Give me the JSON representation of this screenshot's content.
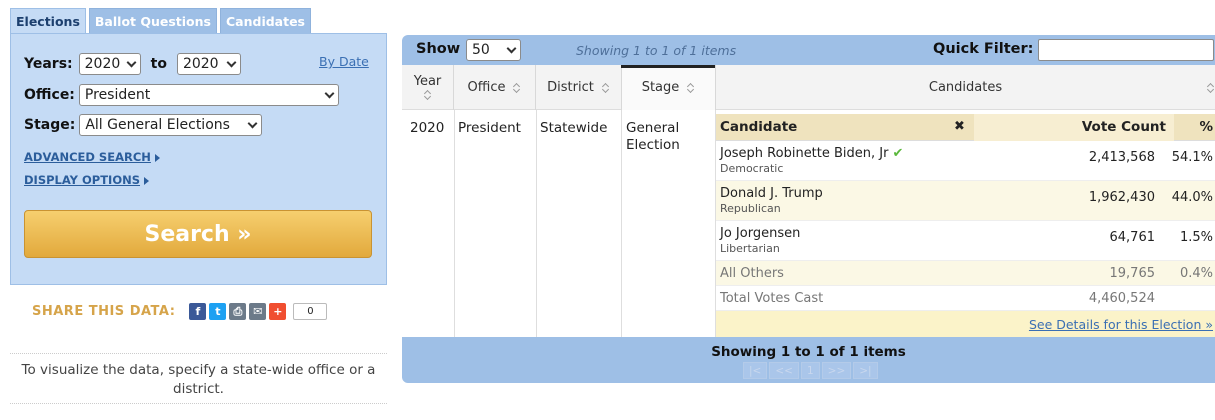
{
  "tabs": [
    {
      "label": "Elections"
    },
    {
      "label": "Ballot Questions"
    },
    {
      "label": "Candidates"
    }
  ],
  "search": {
    "years_label": "Years:",
    "year_from": "2020",
    "to_label": "to",
    "year_to": "2020",
    "by_date": "By Date",
    "office_label": "Office:",
    "office_value": "President",
    "stage_label": "Stage:",
    "stage_value": "All General Elections",
    "advanced_search": "ADVANCED SEARCH",
    "display_options": "DISPLAY OPTIONS",
    "search_button": "Search »"
  },
  "share": {
    "label": "SHARE THIS DATA:",
    "count": "0",
    "buttons": [
      {
        "icon": "facebook-icon",
        "glyph": "f",
        "color": "#3b5998"
      },
      {
        "icon": "twitter-icon",
        "glyph": "t",
        "color": "#1da1f2"
      },
      {
        "icon": "print-icon",
        "glyph": "⎙",
        "color": "#6c7a89"
      },
      {
        "icon": "email-icon",
        "glyph": "✉",
        "color": "#6c7a89"
      },
      {
        "icon": "plus-icon",
        "glyph": "+",
        "color": "#f04e30"
      }
    ]
  },
  "visualize_msg": "To visualize the data, specify a state-wide office or a district.",
  "results": {
    "show_label": "Show",
    "show_value": "50",
    "showing_top": "Showing 1 to 1 of 1 items",
    "quick_filter_label": "Quick Filter:",
    "quick_filter_value": "",
    "columns": {
      "year": "Year",
      "office": "Office",
      "district": "District",
      "stage": "Stage",
      "candidates": "Candidates"
    },
    "row": {
      "year": "2020",
      "office": "President",
      "district": "Statewide",
      "stage": "General Election"
    },
    "cand_headers": {
      "candidate": "Candidate",
      "remove": "✖",
      "votes": "Vote Count",
      "pct": "%"
    },
    "candidates": [
      {
        "name": "Joseph Robinette Biden, Jr",
        "party": "Democratic",
        "votes": "2,413,568",
        "pct": "54.1%",
        "winner": "✔"
      },
      {
        "name": "Donald J. Trump",
        "party": "Republican",
        "votes": "1,962,430",
        "pct": "44.0%"
      },
      {
        "name": "Jo Jorgensen",
        "party": "Libertarian",
        "votes": "64,761",
        "pct": "1.5%"
      }
    ],
    "all_others": {
      "label": "All Others",
      "votes": "19,765",
      "pct": "0.4%"
    },
    "total": {
      "label": "Total Votes Cast",
      "votes": "4,460,524"
    },
    "details_link": "See Details for this Election »",
    "showing_bottom": "Showing 1 to 1 of 1 items",
    "pager": [
      "|<",
      "<<",
      "1",
      ">>",
      ">|"
    ]
  }
}
